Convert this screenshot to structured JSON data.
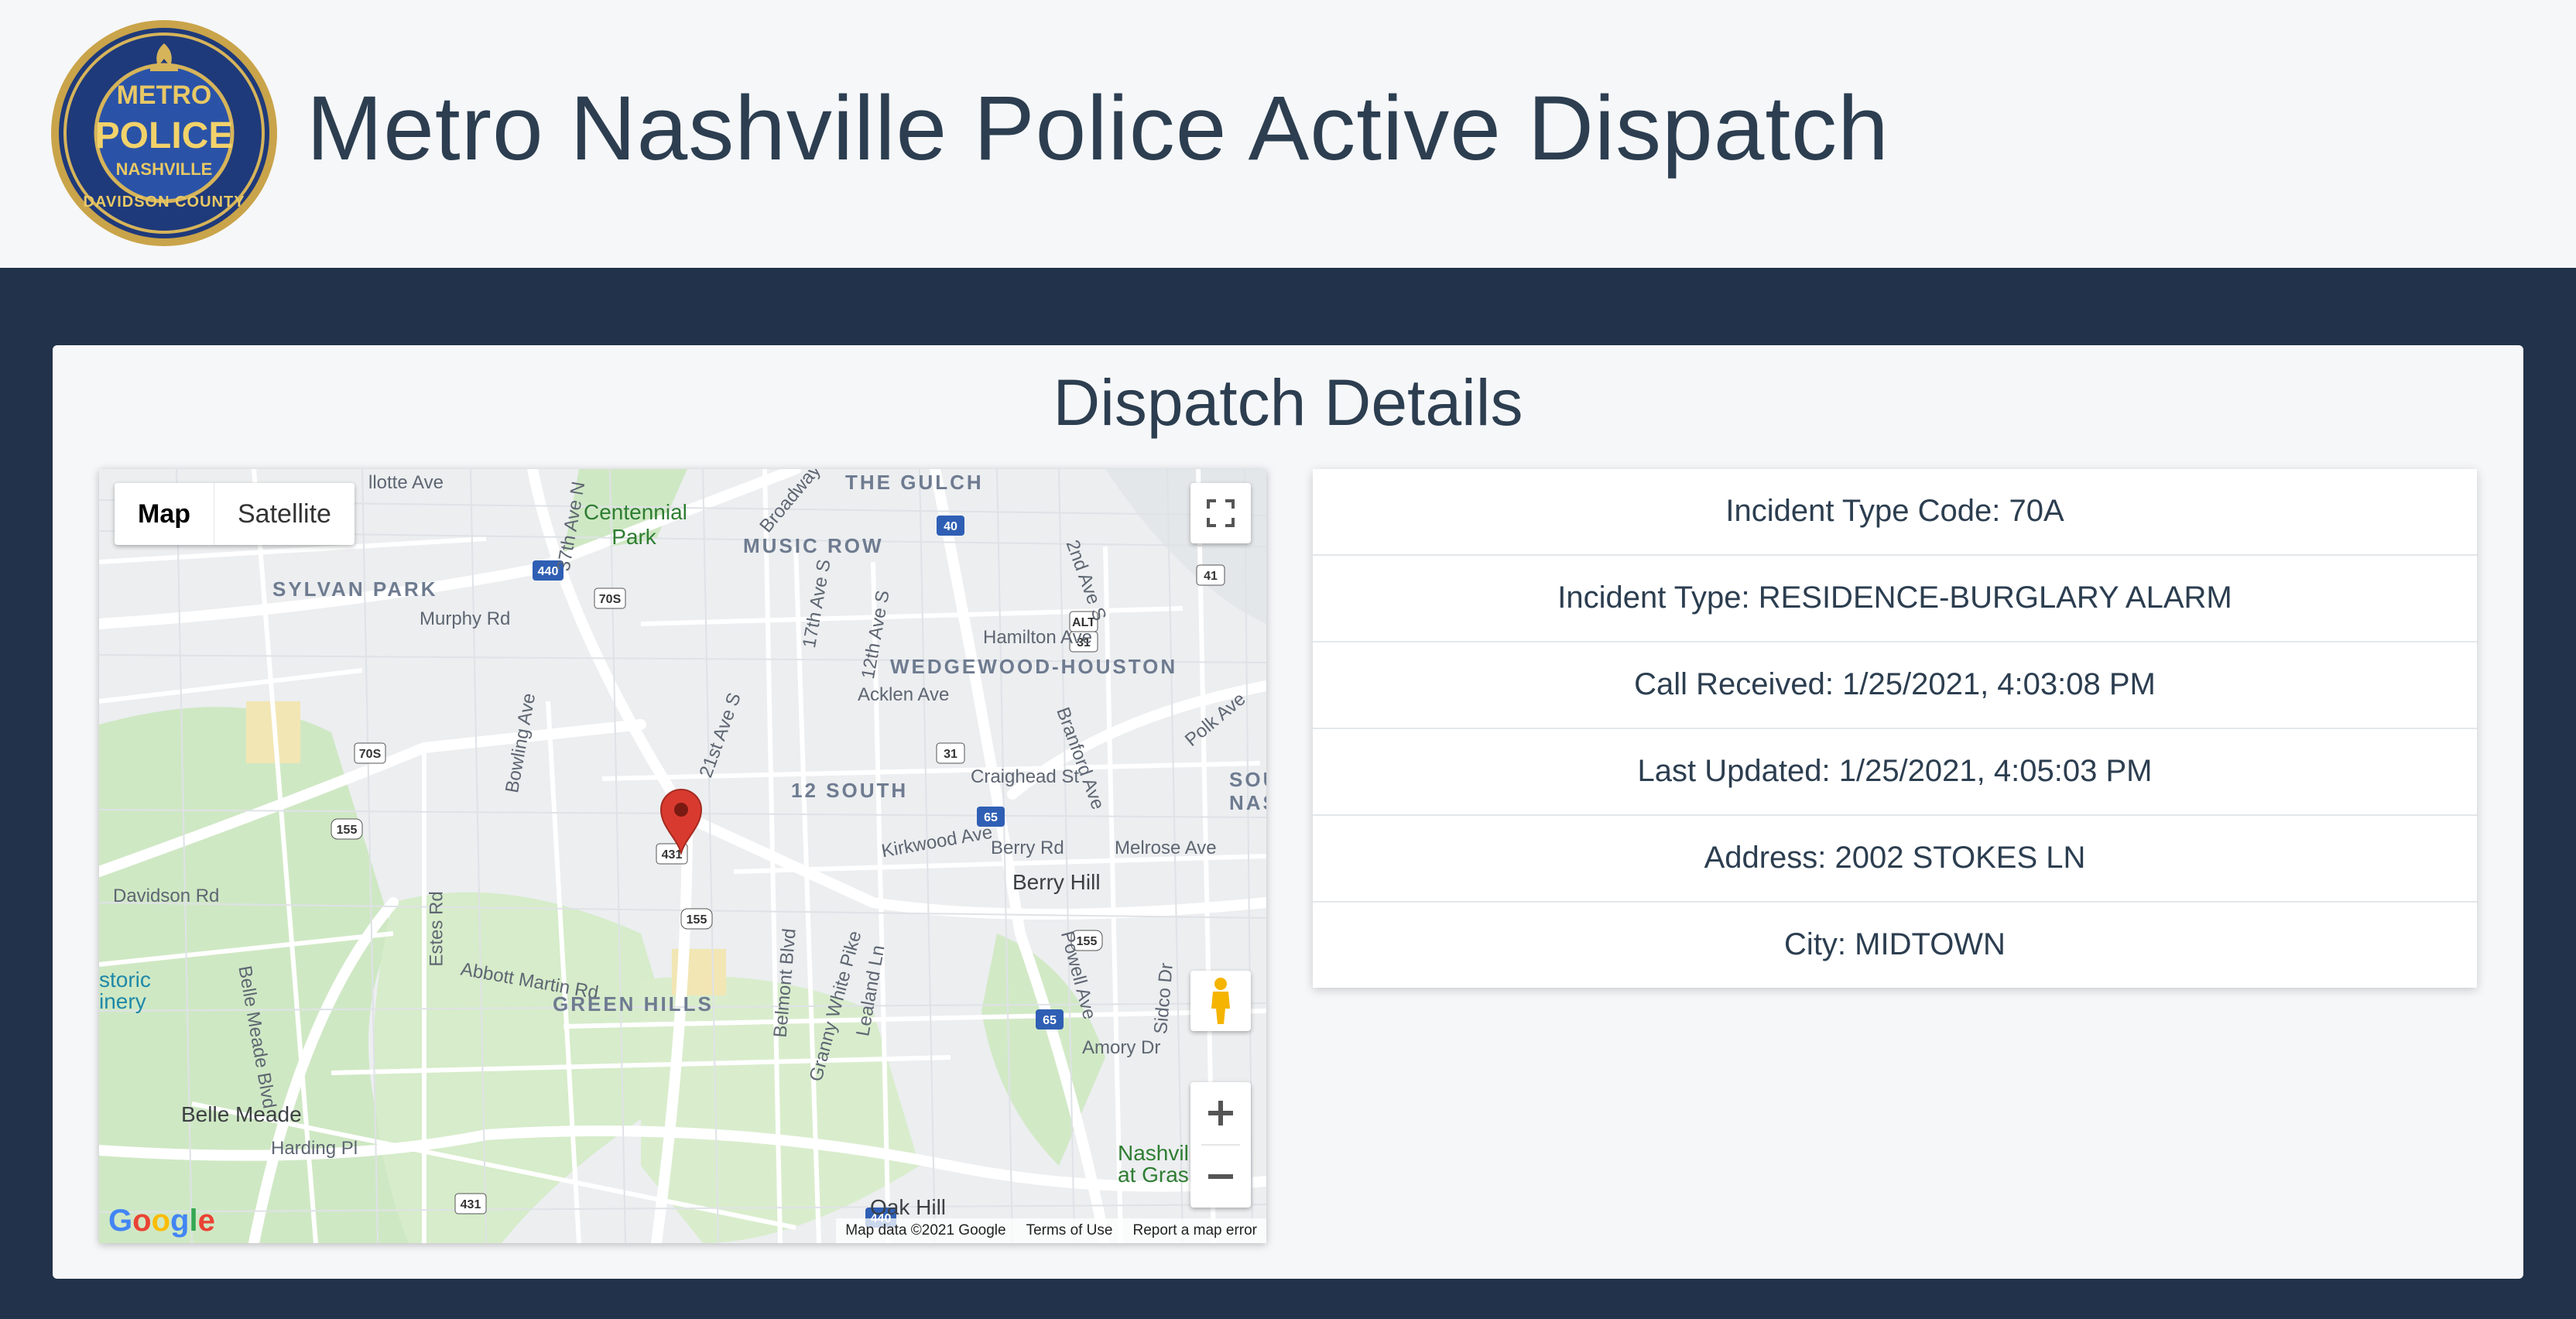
{
  "header": {
    "title": "Metro Nashville Police Active Dispatch",
    "logo": {
      "icon": "police-badge-icon",
      "text_top": "METRO",
      "text_main": "POLICE",
      "text_sub": "NASHVILLE",
      "text_ring": "DAVIDSON COUNTY"
    }
  },
  "card": {
    "title": "Dispatch Details"
  },
  "map": {
    "type_buttons": [
      "Map",
      "Satellite"
    ],
    "selected_type": "Map",
    "footer": {
      "attribution": "Map data ©2021 Google",
      "terms": "Terms of Use",
      "report": "Report a map error"
    },
    "brand": "Google",
    "labels": [
      "llotte Ave",
      "THE GULCH",
      "Centennial Park",
      "Broadway",
      "MUSIC ROW",
      "SYLVAN PARK",
      "Murphy Rd",
      "WEDGEWOOD-HOUSTON",
      "Hamilton Ave",
      "Acklen Ave",
      "12 SOUTH",
      "Craighead St",
      "Kirkwood Ave",
      "Berry Rd",
      "Melrose Ave",
      "Berry Hill",
      "Davidson Rd",
      "Abbott Martin Rd",
      "GREEN HILLS",
      "Belle Meade",
      "Harding Pl",
      "Oak Hill",
      "Nashvil at Gras",
      "storic inery",
      "Estes Rd",
      "Belmont Blvd",
      "Granny White Pike",
      "Lealand Ln",
      "Powell Ave",
      "Amory Dr",
      "21st Ave S",
      "2nd Ave S",
      "Polk Ave",
      "SOU NASH",
      "Bowling Ave",
      "37th Ave N",
      "17th Ave S",
      "12th Ave S",
      "Belle Meade Blvd",
      "Sidco Dr",
      "Branford Ave"
    ],
    "shields": [
      "440",
      "70S",
      "40",
      "41",
      "31",
      "ALT",
      "155",
      "431",
      "65"
    ]
  },
  "details": {
    "rows": [
      "Incident Type Code: 70A",
      "Incident Type: RESIDENCE-BURGLARY ALARM",
      "Call Received: 1/25/2021, 4:03:08 PM",
      "Last Updated: 1/25/2021, 4:05:03 PM",
      "Address: 2002 STOKES LN",
      "City: MIDTOWN"
    ]
  },
  "colors": {
    "band": "#21324a",
    "title_text": "#2c3e50",
    "pin": "#d93a2f",
    "map_green": "#cfe8c4",
    "map_road": "#ffffff"
  }
}
